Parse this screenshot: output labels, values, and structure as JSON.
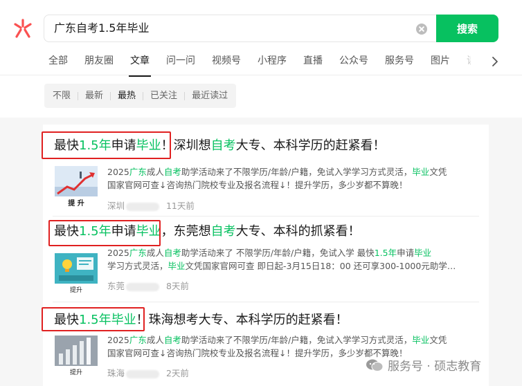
{
  "search": {
    "query": "广东自考1.5年毕业",
    "button_label": "搜索"
  },
  "tabs": [
    {
      "label": "全部"
    },
    {
      "label": "朋友圈"
    },
    {
      "label": "文章",
      "active": true
    },
    {
      "label": "问一问"
    },
    {
      "label": "视频号"
    },
    {
      "label": "小程序"
    },
    {
      "label": "直播"
    },
    {
      "label": "公众号"
    },
    {
      "label": "服务号"
    },
    {
      "label": "图片"
    },
    {
      "label": "读"
    }
  ],
  "filters": [
    {
      "label": "不限"
    },
    {
      "label": "最新"
    },
    {
      "label": "最热",
      "active": true
    },
    {
      "label": "已关注"
    },
    {
      "label": "最近读过"
    }
  ],
  "results": [
    {
      "title_parts": [
        "最快",
        "1.5年",
        "申请",
        "毕业",
        "！深圳想",
        "自考",
        "大专、本科学历的赶紧看！"
      ],
      "desc_line1": [
        "2025",
        "广东",
        "成人",
        "自考",
        "助学活动来了不限学历/年龄/户籍，免试入学学习方式灵活，",
        "毕业",
        "文凭"
      ],
      "desc_line2": "国家官网可查↓咨询热门院校专业及报名流程↓！提升学历，多少岁都不算晚！",
      "source": "深圳",
      "time": "11天前",
      "thumb_caption": "提 升"
    },
    {
      "title_parts": [
        "最快",
        "1.5年",
        "申请",
        "毕业",
        "，东莞想",
        "自考",
        "大专、本科的抓紧看！"
      ],
      "desc_line1": [
        "2025",
        "广东",
        "成人",
        "自考",
        "助学活动来了 不限学历/年龄/户籍，免试入学 最快",
        "1.5年",
        "申请",
        "毕业"
      ],
      "desc_line2_parts": [
        "学习方式灵活，",
        "毕业",
        "文凭国家官网可查 即日起-3月15日18：00 还可享300-1000元助学…"
      ],
      "source": "东莞",
      "time": "8天前",
      "thumb_caption": "提升"
    },
    {
      "title_parts": [
        "最快",
        "1.5年毕业",
        "！珠海想考大专、本科学历的赶紧看！"
      ],
      "desc_line1": [
        "2025",
        "广东",
        "成人",
        "自考",
        "助学活动来了不限学历/年龄/户籍，免试入学学习方式灵活，",
        "毕业",
        "文凭"
      ],
      "desc_line2": "国家官网可查↓咨询热门院校专业及报名流程↓！提升学历，多少岁都不算晚！",
      "source": "珠海",
      "time": "2天前",
      "thumb_caption": "提升"
    }
  ],
  "watermark": {
    "text": "服务号 · 硕志教育"
  },
  "colors": {
    "accent": "#07c160",
    "highlight_box": "#e02020"
  }
}
